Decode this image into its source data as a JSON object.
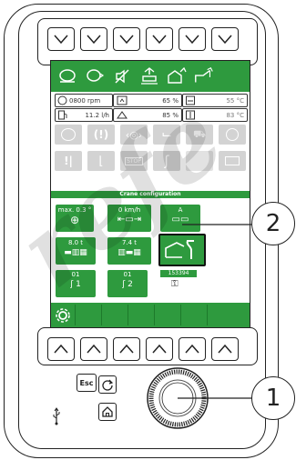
{
  "status_row1": {
    "rpm": "0800 rpm",
    "percent1": "65 %",
    "temp1": "55 °C"
  },
  "status_row2": {
    "consumption": "11.2 l/h",
    "percent2": "85 %",
    "temp2": "83 °C"
  },
  "section_title": "Crane configuration",
  "config": {
    "tilt_label": "max. 0.3 °",
    "speed_label": "0 km/h",
    "mode_label": "A",
    "load1_label": "8.0 t",
    "load2_label": "7.4 t",
    "hook1_top": "01",
    "hook1_num": "1",
    "hook2_top": "01",
    "hook2_num": "2",
    "serial": "153394"
  },
  "hardware": {
    "esc_label": "Esc"
  },
  "callouts": {
    "c1": "1",
    "c2": "2"
  },
  "watermark": "refe",
  "colors": {
    "screen_green": "#2e9a3e",
    "tile_gray": "#d3d3d3"
  }
}
